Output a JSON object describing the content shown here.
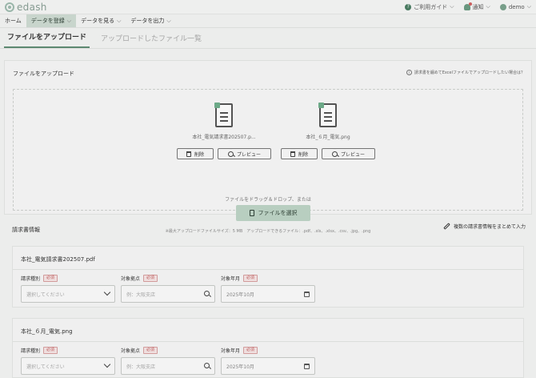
{
  "app": {
    "logo": "edash"
  },
  "header": {
    "guide": "ご利用ガイド",
    "notify": "通知",
    "user": "demo"
  },
  "nav": {
    "items": [
      {
        "label": "ホーム"
      },
      {
        "label": "データを登録"
      },
      {
        "label": "データを見る"
      },
      {
        "label": "データを出力"
      }
    ]
  },
  "tabs": {
    "upload": "ファイルをアップロード",
    "list": "アップロードしたファイル一覧"
  },
  "upload": {
    "title": "ファイルをアップロード",
    "help": "請求書を纏めてExcelファイルでアップロードしたい場合は？",
    "files": [
      {
        "name": "本社_電気請求書202507.p..."
      },
      {
        "name": "本社_６月_電気.png"
      }
    ],
    "delete_label": "削除",
    "preview_label": "プレビュー",
    "drag_text": "ファイルをドラッグ＆ドロップ、または",
    "select_label": "ファイルを選択",
    "limit_text": "※最大アップロードファイルサイズ：5 MB　アップロードできるファイル：.pdf、.xls、.xlsx、.csv、.jpg、.png"
  },
  "invoice_section": {
    "title": "請求書情報",
    "bulk_label": "複数の請求書情報をまとめて入力"
  },
  "invoices": [
    {
      "file": "本社_電気請求書202507.pdf",
      "type_label": "請求種別",
      "type_placeholder": "選択してください",
      "site_label": "対象拠点",
      "site_placeholder": "例：大阪支店",
      "month_label": "対象年月",
      "month_value": "2025年10月"
    },
    {
      "file": "本社_６月_電気.png",
      "type_label": "請求種別",
      "type_placeholder": "選択してください",
      "site_label": "対象拠点",
      "site_placeholder": "例：大阪支店",
      "month_label": "対象年月",
      "month_value": "2025年10月"
    }
  ],
  "required_label": "必須"
}
